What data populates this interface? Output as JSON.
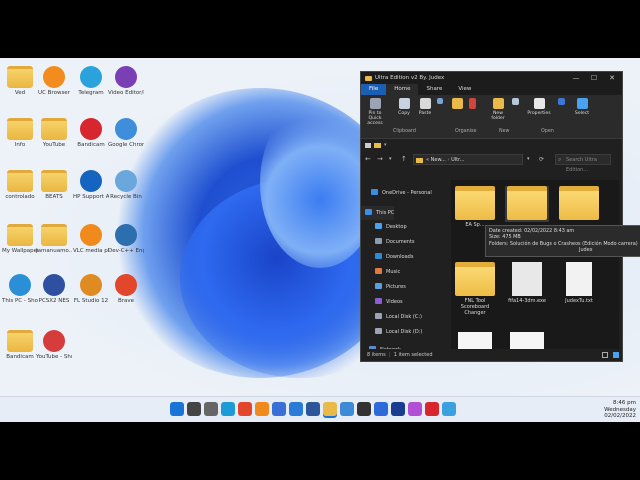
{
  "desktop": {
    "icons": [
      {
        "label": "Ved",
        "kind": "folder"
      },
      {
        "label": "UC Browser",
        "kind": "app",
        "color": "#f28c1e"
      },
      {
        "label": "Telegram",
        "kind": "app",
        "color": "#2aa2dc"
      },
      {
        "label": "Video Editor/Maker",
        "kind": "app",
        "color": "#7b3fb5"
      },
      {
        "label": "Info",
        "kind": "folder"
      },
      {
        "label": "YouTube",
        "kind": "folder"
      },
      {
        "label": "Bandicam",
        "kind": "app",
        "color": "#d8262e"
      },
      {
        "label": "Google Chrome",
        "kind": "app",
        "color": "#3f8edc"
      },
      {
        "label": "controlado",
        "kind": "folder"
      },
      {
        "label": "BEATS",
        "kind": "folder"
      },
      {
        "label": "HP Support Assistant",
        "kind": "app",
        "color": "#1565c0"
      },
      {
        "label": "Recycle Bin",
        "kind": "app",
        "color": "#6aa7dc"
      },
      {
        "label": "My Wallpapers",
        "kind": "folder"
      },
      {
        "label": "Jamanuamo...",
        "kind": "folder"
      },
      {
        "label": "VLC media player",
        "kind": "app",
        "color": "#f08a1c"
      },
      {
        "label": "Dev-C++ Engine",
        "kind": "app",
        "color": "#2c6eae"
      },
      {
        "label": "This PC - Shortcut",
        "kind": "app",
        "color": "#2a8fd6"
      },
      {
        "label": "PCSX2 NES",
        "kind": "app",
        "color": "#2f4fa0"
      },
      {
        "label": "FL Studio 12",
        "kind": "app",
        "color": "#e08b22"
      },
      {
        "label": "Brave",
        "kind": "app",
        "color": "#e2462b"
      },
      {
        "label": "Bandicam",
        "kind": "folder"
      },
      {
        "label": "YouTube - Shortcut",
        "kind": "app",
        "color": "#d63c3c"
      }
    ]
  },
  "taskbar": {
    "time": "8:46 pm",
    "day": "Wednesday",
    "date": "02/02/2022",
    "apps": [
      "start-icon",
      "search-icon",
      "taskview-icon",
      "edge-icon",
      "brave-icon",
      "vlc-icon",
      "store-icon",
      "mail-icon",
      "word-icon",
      "explorer-icon",
      "dropbox-icon",
      "media-icon",
      "apps-icon",
      "ps-icon",
      "game-icon",
      "record-icon",
      "photos-icon"
    ]
  },
  "window": {
    "title": "Ultra Edition v2 By. Judex",
    "minimize": "—",
    "maximize": "☐",
    "close": "✕",
    "tabs": [
      "File",
      "Home",
      "Share",
      "View"
    ],
    "ribbon": {
      "buttons": [
        "Pin to Quick access",
        "Copy",
        "Paste",
        "New folder",
        "Properties",
        "Select"
      ],
      "groups": [
        "Clipboard",
        "Organise",
        "New",
        "Open"
      ]
    },
    "path": [
      "« New...",
      "Ultr..."
    ],
    "search_placeholder": "Search Ultra Edition...",
    "nav": [
      "OneDrive - Personal",
      "This PC",
      "Desktop",
      "Documents",
      "Downloads",
      "Music",
      "Pictures",
      "Videos",
      "Local Disk (C:)",
      "Local Disk (D:)",
      "Network"
    ],
    "items": [
      {
        "label": "EA Sp...",
        "kind": "folder"
      },
      {
        "label": "",
        "kind": "folder"
      },
      {
        "label": "",
        "kind": "folder"
      },
      {
        "label": "FNL Tool Scoreboard Changer",
        "kind": "folder"
      },
      {
        "label": "fifa14-3dm.exe",
        "kind": "exe"
      },
      {
        "label": "JudexTu.txt",
        "kind": "txt"
      },
      {
        "label": "",
        "kind": "file"
      },
      {
        "label": "",
        "kind": "file"
      }
    ],
    "tooltip": {
      "created": "Date created: 02/02/2022 8:43 am",
      "size": "Size: 475 MB",
      "folders": "Folders: Solución de Bugs o Crasheos (Edición Modo carrera)",
      "tail": "Judex"
    },
    "status": {
      "count": "8 items",
      "selected": "1 item selected"
    }
  }
}
